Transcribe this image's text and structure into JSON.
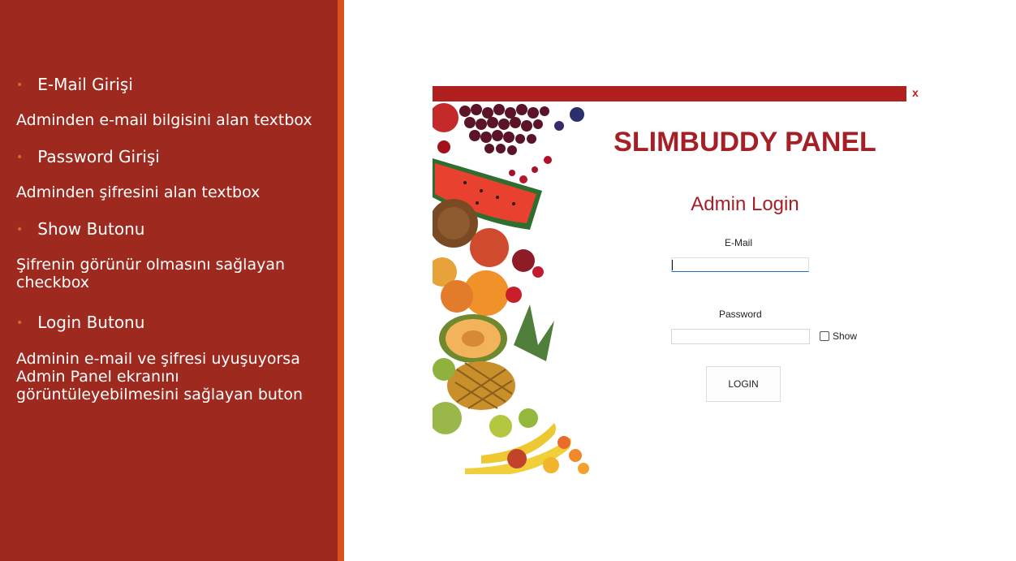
{
  "slide": {
    "items": [
      {
        "bullet": "E-Mail Girişi",
        "description": "Adminden e-mail bilgisini alan textbox"
      },
      {
        "bullet": "Password Girişi",
        "description": "Adminden şifresini alan textbox"
      },
      {
        "bullet": "Show Butonu",
        "description": "Şifrenin görünür olmasını sağlayan checkbox"
      },
      {
        "bullet": "Login Butonu",
        "description": "Adminin e-mail ve şifresi uyuşuyorsa Admin Panel ekranını görüntüleyebilmesini sağlayan buton"
      }
    ],
    "colors": {
      "panel": "#9e2a1f",
      "stripe": "#d9521e",
      "bullet": "#e5632a"
    }
  },
  "app": {
    "close_label": "x",
    "brand": "SLIMBUDDY PANEL",
    "subtitle": "Admin Login",
    "email_label": "E-Mail",
    "email_value": "",
    "password_label": "Password",
    "password_value": "",
    "show_label": "Show",
    "show_checked": false,
    "login_label": "LOGIN",
    "colors": {
      "accent": "#a51f26",
      "titlebar": "#b0201f"
    },
    "image": "fruit-assortment-image"
  }
}
